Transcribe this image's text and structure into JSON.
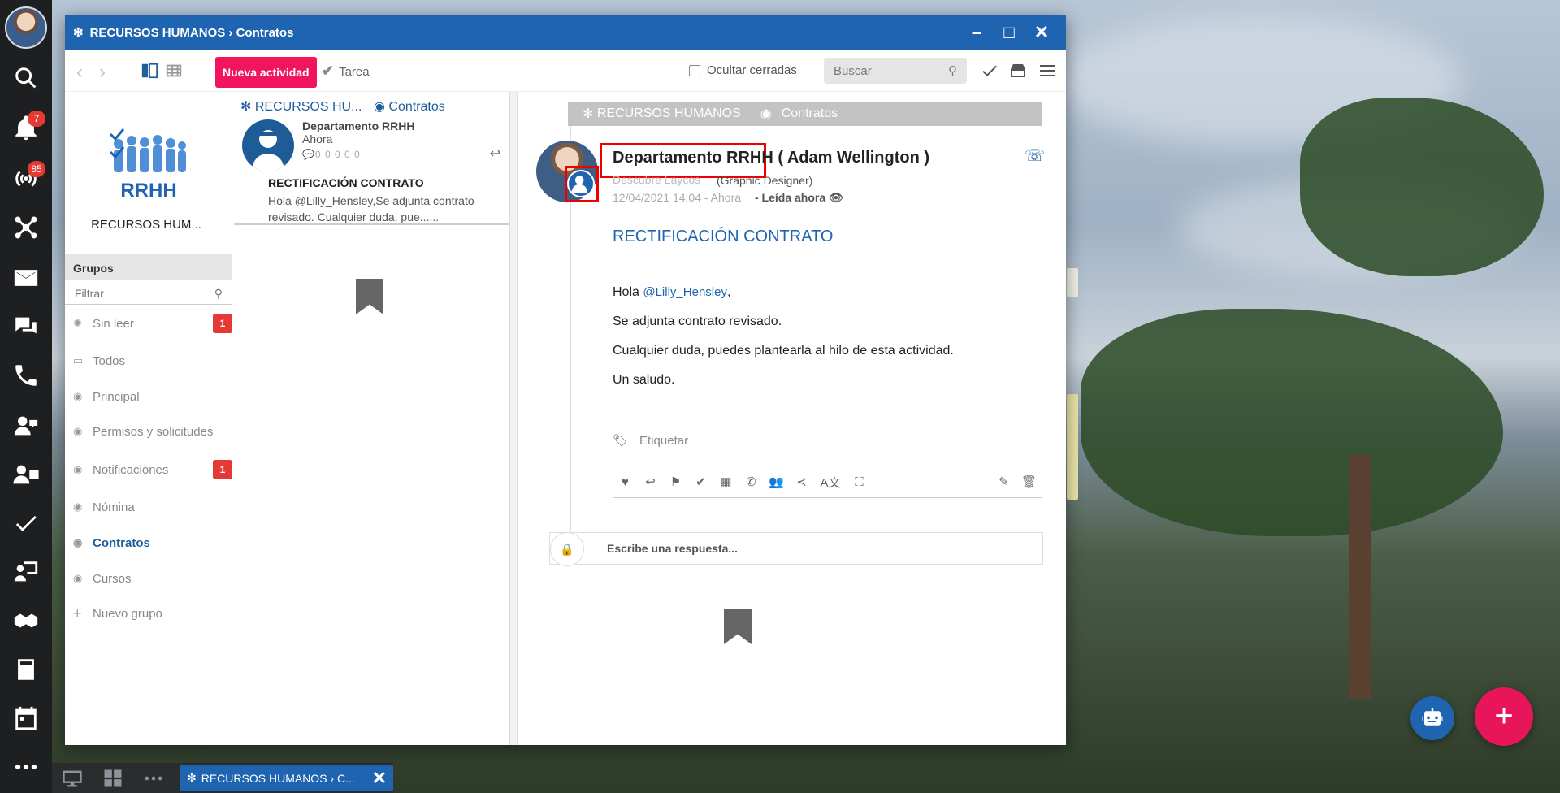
{
  "dock": {
    "notifications_badge": "7",
    "radio_badge": "85"
  },
  "window": {
    "title": "RECURSOS HUMANOS › Contratos",
    "minimize": "–",
    "maximize": "□",
    "close": "✕"
  },
  "toolbar": {
    "new_activity": "Nueva actividad",
    "task": "Tarea",
    "hide_closed": "Ocultar cerradas",
    "search_placeholder": "Buscar"
  },
  "groups": {
    "logo_text": "RRHH",
    "entity_name": "RECURSOS HUM...",
    "header": "Grupos",
    "filter_placeholder": "Filtrar",
    "items": [
      {
        "label": "Sin leer",
        "badge": "1"
      },
      {
        "label": "Todos"
      },
      {
        "label": "Principal"
      },
      {
        "label": "Permisos y solicitudes"
      },
      {
        "label": "Notificaciones",
        "badge": "1"
      },
      {
        "label": "Nómina"
      },
      {
        "label": "Contratos"
      },
      {
        "label": "Cursos"
      },
      {
        "label": "Nuevo grupo"
      }
    ]
  },
  "list": {
    "crumb_entity": "RECURSOS HU...",
    "crumb_group": "Contratos",
    "card": {
      "sender": "Departamento RRHH",
      "when": "Ahora",
      "counters": "0 0 0 0 0",
      "subject": "RECTIFICACIÓN CONTRATO",
      "preview": "Hola @Lilly_Hensley,Se adjunta contrato revisado. Cualquier duda, pue......"
    }
  },
  "detail": {
    "crumb_entity": "RECURSOS HUMANOS",
    "crumb_group": "Contratos",
    "title": "Departamento RRHH ( Adam Wellington )",
    "source": "Descubre Laycos",
    "role": "(Graphic Designer)",
    "date": "12/04/2021 14:04 - Ahora",
    "read": "- Leída ahora",
    "subject": "RECTIFICACIÓN CONTRATO",
    "greeting": "Hola",
    "mention": "@Lilly_Hensley",
    "line1": "Se adjunta contrato revisado.",
    "line2": "Cualquier duda, puedes plantearla al hilo de esta actividad.",
    "line3": "Un saludo.",
    "tag_label": "Etiquetar",
    "reply_placeholder": "Escribe una respuesta..."
  },
  "taskbar": {
    "window_label": "RECURSOS HUMANOS › C..."
  },
  "colors": {
    "primary": "#1f64b0",
    "accent": "#f0155d",
    "badge": "#e53935"
  }
}
